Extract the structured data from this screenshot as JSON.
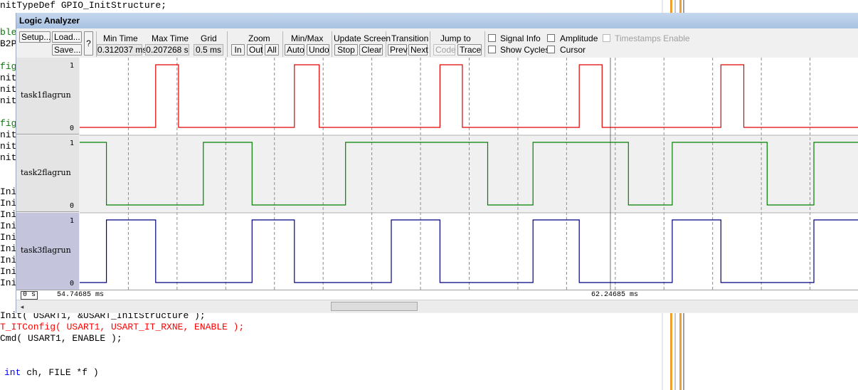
{
  "editor": {
    "lines": [
      {
        "text": "nitTypeDef GPIO_InitStructure;",
        "color": "#000000"
      },
      {
        "text": "ble",
        "color": "#008000"
      },
      {
        "text": "B2P",
        "color": "#000000"
      },
      {
        "text": "fig",
        "color": "#008000"
      },
      {
        "text": "nit",
        "color": "#000000"
      },
      {
        "text": "nit",
        "color": "#000000"
      },
      {
        "text": "nit",
        "color": "#000000"
      },
      {
        "text": "fig",
        "color": "#008000"
      },
      {
        "text": "nit",
        "color": "#000000"
      },
      {
        "text": "nit",
        "color": "#000000"
      },
      {
        "text": "nit",
        "color": "#000000"
      },
      {
        "text": "Ini",
        "color": "#000000"
      },
      {
        "text": "Ini",
        "color": "#000000"
      },
      {
        "text": "Ini",
        "color": "#000000"
      },
      {
        "text": "Ini",
        "color": "#000000"
      },
      {
        "text": "Ini",
        "color": "#000000"
      },
      {
        "text": "Ini",
        "color": "#000000"
      },
      {
        "text": "Ini",
        "color": "#000000"
      },
      {
        "text": "Ini",
        "color": "#000000"
      },
      {
        "text": "Ini",
        "color": "#000000"
      },
      {
        "text": "Init( USART1, &USART_InitStructure );",
        "color": "#000000"
      },
      {
        "text": "T_ITConfig( USART1, USART_IT_RXNE, ENABLE );",
        "color": "#ff0000"
      },
      {
        "text": "Cmd( USART1, ENABLE );",
        "color": "#000000"
      }
    ],
    "fn_keyword": "int",
    "fn_rest": " ch, FILE *f )",
    "keyword_color": "#0000ff"
  },
  "window": {
    "title": "Logic Analyzer"
  },
  "toolbar": {
    "setup": "Setup...",
    "load": "Load...",
    "save": "Save...",
    "help": "?",
    "min_time_label": "Min Time",
    "min_time_value": "0.312037 ms",
    "max_time_label": "Max Time",
    "max_time_value": "0.207268 s",
    "grid_label": "Grid",
    "grid_value": "0.5 ms",
    "zoom_label": "Zoom",
    "zoom_in": "In",
    "zoom_out": "Out",
    "zoom_all": "All",
    "minmax_label": "Min/Max",
    "auto": "Auto",
    "undo": "Undo",
    "update_label": "Update Screen",
    "stop": "Stop",
    "clear": "Clear",
    "transition_label": "Transition",
    "prev": "Prev",
    "next": "Next",
    "jump_label": "Jump to",
    "code": "Code",
    "trace": "Trace",
    "signal_info": "Signal Info",
    "show_cycles": "Show Cycles",
    "amplitude": "Amplitude",
    "cursor": "Cursor",
    "timestamps": "Timestamps Enable"
  },
  "signals": [
    {
      "name": "task1flagrun",
      "color": "#e00000",
      "high": "1",
      "low": "0",
      "start": 0,
      "transitions": [
        1.56,
        2.03,
        4.41,
        4.92,
        7.4,
        7.86,
        10.26,
        10.73,
        13.17,
        13.64
      ]
    },
    {
      "name": "task2flagrun",
      "color": "#008000",
      "high": "1",
      "low": "0",
      "start": 1,
      "transitions": [
        0.55,
        2.54,
        3.54,
        5.46,
        8.38,
        9.31,
        11.27,
        12.17,
        14.12,
        15.08
      ]
    },
    {
      "name": "task3flagrun",
      "color": "#000080",
      "high": "1",
      "low": "0",
      "start": 0,
      "transitions": [
        0.55,
        1.56,
        3.54,
        4.41,
        6.4,
        7.4,
        9.31,
        10.26,
        12.17,
        13.17,
        15.08
      ]
    }
  ],
  "time_axis": {
    "start": "0 s",
    "left_time": "54.74685 ms",
    "cursor_time": "62.24685 ms",
    "grid_count": 16,
    "cursor_index": 10.9
  }
}
